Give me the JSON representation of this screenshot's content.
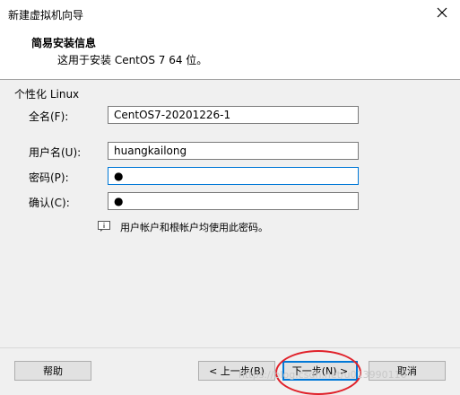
{
  "window": {
    "title": "新建虚拟机向导"
  },
  "header": {
    "title": "简易安装信息",
    "subtitle": "这用于安装 CentOS 7 64 位。"
  },
  "group": {
    "label": "个性化 Linux"
  },
  "form": {
    "fullname_label": "全名(F):",
    "fullname_value": "CentOS7-20201226-1",
    "username_label": "用户名(U):",
    "username_value": "huangkailong",
    "password_label": "密码(P):",
    "password_value": "●",
    "confirm_label": "确认(C):",
    "confirm_value": "●"
  },
  "info": {
    "icon": "info-icon",
    "text": "用户帐户和根帐户均使用此密码。"
  },
  "buttons": {
    "help": "帮助",
    "back": "< 上一步(B)",
    "next": "下一步(N) >",
    "cancel": "取消"
  },
  "watermark": "https://blog.csdn.net/u013990110",
  "colors": {
    "annotation": "#e0212a",
    "focus_border": "#0078d7",
    "panel_background": "#f0f0f0"
  }
}
